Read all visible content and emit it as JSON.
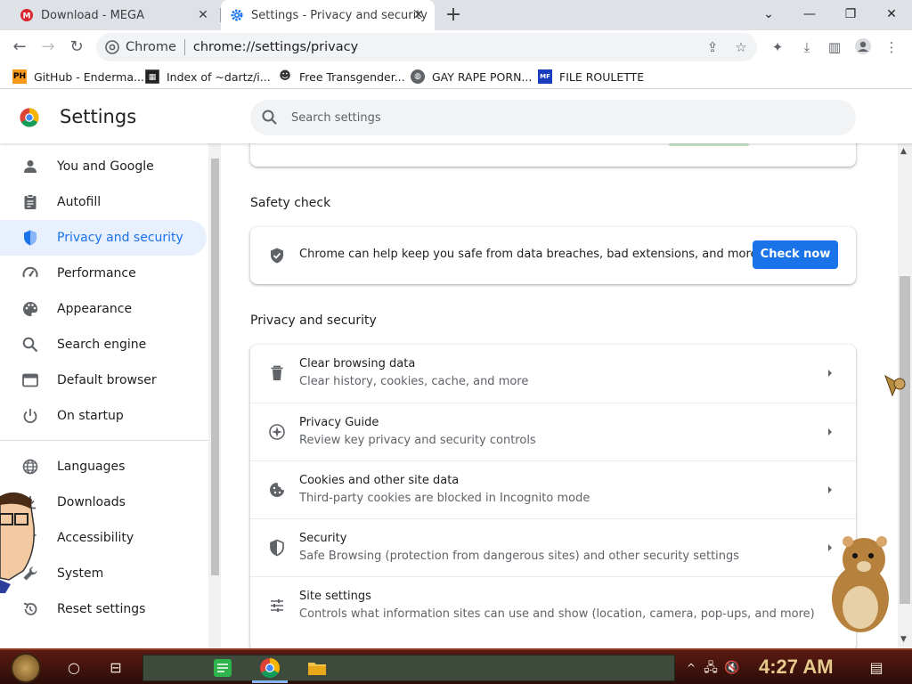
{
  "tabs": [
    {
      "title": "Download - MEGA",
      "favicon": "mega-icon",
      "active": false
    },
    {
      "title": "Settings - Privacy and security",
      "favicon": "settings-gear-icon",
      "active": true
    }
  ],
  "window_controls": {
    "minimize": "minimize-icon",
    "maximize": "restore-icon",
    "close": "close-icon"
  },
  "omnibox": {
    "site_label": "Chrome",
    "url": "chrome://settings/privacy"
  },
  "bookmarks": [
    {
      "label": "GitHub - Enderma...",
      "icon": "ph-icon"
    },
    {
      "label": "Index of ~dartz/i...",
      "icon": "index-icon"
    },
    {
      "label": "Free Transgender...",
      "icon": "mask-icon"
    },
    {
      "label": "GAY RAPE PORN...",
      "icon": "globe-icon"
    },
    {
      "label": "FILE ROULETTE",
      "icon": "file-roulette-icon"
    }
  ],
  "settings": {
    "title": "Settings",
    "search_placeholder": "Search settings"
  },
  "sidebar": {
    "items": [
      {
        "label": "You and Google",
        "icon": "person-icon",
        "active": false
      },
      {
        "label": "Autofill",
        "icon": "clipboard-icon",
        "active": false
      },
      {
        "label": "Privacy and security",
        "icon": "shield-icon",
        "active": true
      },
      {
        "label": "Performance",
        "icon": "speedometer-icon",
        "active": false
      },
      {
        "label": "Appearance",
        "icon": "palette-icon",
        "active": false
      },
      {
        "label": "Search engine",
        "icon": "search-icon",
        "active": false
      },
      {
        "label": "Default browser",
        "icon": "browser-icon",
        "active": false
      },
      {
        "label": "On startup",
        "icon": "power-icon",
        "active": false
      }
    ],
    "advanced_items": [
      {
        "label": "Languages",
        "icon": "globe-icon"
      },
      {
        "label": "Downloads",
        "icon": "download-icon"
      },
      {
        "label": "Accessibility",
        "icon": "accessibility-icon"
      },
      {
        "label": "System",
        "icon": "wrench-icon"
      },
      {
        "label": "Reset settings",
        "icon": "reset-icon"
      }
    ]
  },
  "safety_check": {
    "heading": "Safety check",
    "text": "Chrome can help keep you safe from data breaches, bad extensions, and more",
    "button": "Check now"
  },
  "privacy_section": {
    "heading": "Privacy and security",
    "rows": [
      {
        "title": "Clear browsing data",
        "subtitle": "Clear history, cookies, cache, and more",
        "icon": "trash-icon"
      },
      {
        "title": "Privacy Guide",
        "subtitle": "Review key privacy and security controls",
        "icon": "compass-icon"
      },
      {
        "title": "Cookies and other site data",
        "subtitle": "Third-party cookies are blocked in Incognito mode",
        "icon": "cookie-icon"
      },
      {
        "title": "Security",
        "subtitle": "Safe Browsing (protection from dangerous sites) and other security settings",
        "icon": "shield-icon"
      },
      {
        "title": "Site settings",
        "subtitle": "Controls what information sites can use and show (location, camera, pop-ups, and more)",
        "icon": "sliders-icon"
      }
    ]
  },
  "taskbar": {
    "clock": "4:27 AM"
  },
  "colors": {
    "accent": "#1a73e8",
    "active_nav_bg": "#e8f0fe",
    "tabstrip": "#dee1e6",
    "taskbar": "#4a160f"
  }
}
